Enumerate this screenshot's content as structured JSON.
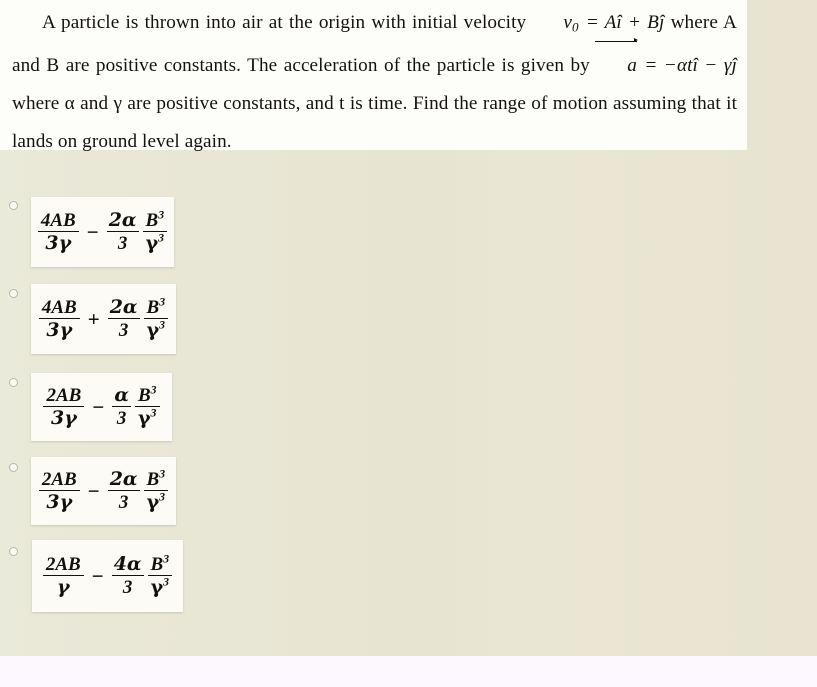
{
  "question": {
    "line1_a": "A particle is thrown into air at the origin with initial velocity ",
    "v_symbol": "v",
    "v_sub": "0",
    "eq1": " = A",
    "i_hat": "î",
    "plus": " + B",
    "j_hat": "ĵ",
    "line2": " where A and B are positive constants. The acceleration of the particle is given by ",
    "a_symbol": "a",
    "eq2": " = −αt",
    "i_hat2": "î",
    "minus2": " − γ",
    "j_hat2": "ĵ",
    "line3": " where α and γ are positive constants, and t is time. Find the range of motion assuming that it lands on ground level again.",
    "full_text": "A particle is thrown into air at the origin with initial velocity v⃗₀ = Aî + Bĵ where A and B are positive constants. The acceleration of the particle is given by a⃗ = −αtî − γĵ where α and γ are positive constants, and t is time. Find the range of motion assuming that it lands on ground level again."
  },
  "options": [
    {
      "id": "option-1",
      "text": "4AB/3γ − (2α/3)(B³/γ³)",
      "term1_num": "4AB",
      "term1_den": "3γ",
      "operator": "−",
      "coef_num": "2α",
      "coef_den": "3",
      "term2_num": "B",
      "term2_num_pow": "3",
      "term2_den": "γ",
      "term2_den_pow": "3",
      "selected": false
    },
    {
      "id": "option-2",
      "text": "4AB/3γ + (2α/3)(B³/γ³)",
      "term1_num": "4AB",
      "term1_den": "3γ",
      "operator": "+",
      "coef_num": "2α",
      "coef_den": "3",
      "term2_num": "B",
      "term2_num_pow": "3",
      "term2_den": "γ",
      "term2_den_pow": "3",
      "selected": false
    },
    {
      "id": "option-3",
      "text": "2AB/3γ − (α/3)(B³/γ³)",
      "term1_num": "2AB",
      "term1_den": "3γ",
      "operator": "−",
      "coef_num": "α",
      "coef_den": "3",
      "term2_num": "B",
      "term2_num_pow": "3",
      "term2_den": "γ",
      "term2_den_pow": "3",
      "selected": false
    },
    {
      "id": "option-4",
      "text": "2AB/3γ − (2α/3)(B³/γ³)",
      "term1_num": "2AB",
      "term1_den": "3γ",
      "operator": "−",
      "coef_num": "2α",
      "coef_den": "3",
      "term2_num": "B",
      "term2_num_pow": "3",
      "term2_den": "γ",
      "term2_den_pow": "3",
      "selected": false
    },
    {
      "id": "option-5",
      "text": "2AB/γ − (4α/3)(B³/γ³)",
      "term1_num": "2AB",
      "term1_den": "γ",
      "operator": "−",
      "coef_num": "4α",
      "coef_den": "3",
      "term2_num": "B",
      "term2_num_pow": "3",
      "term2_den": "γ",
      "term2_den_pow": "3",
      "selected": false
    }
  ],
  "colors": {
    "page_background": "#e8e4d2",
    "panel_background": "#fdfdfa",
    "card_background": "#fcfbf6",
    "text": "#15120e",
    "radio_border": "#b9b7a3",
    "bottom_strip": "#fdf8ff"
  }
}
